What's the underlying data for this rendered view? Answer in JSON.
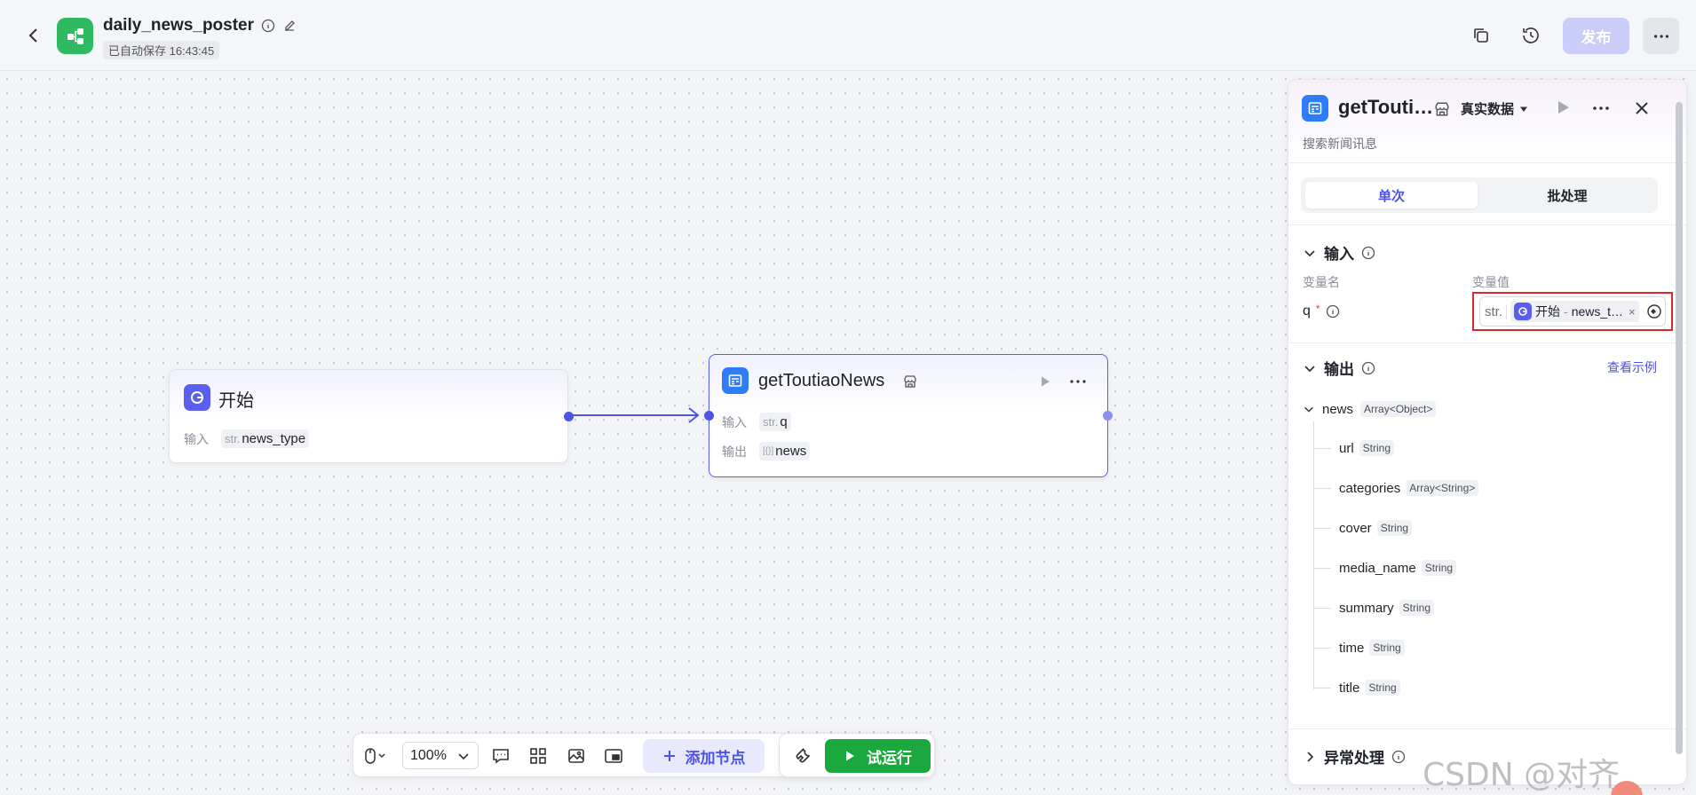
{
  "header": {
    "title": "daily_news_poster",
    "autosave": "已自动保存 16:43:45",
    "publish_label": "发布"
  },
  "canvas": {
    "start_node": {
      "title": "开始",
      "input_label": "输入",
      "input_type": "str.",
      "input_name": "news_type"
    },
    "news_node": {
      "title": "getToutiaoNews",
      "input_label": "输入",
      "input_type": "str.",
      "input_name": "q",
      "output_label": "输出",
      "output_type": "[{}]",
      "output_name": "news"
    }
  },
  "toolbar": {
    "zoom": "100%",
    "add_node_label": "添加节点",
    "run_label": "试运行"
  },
  "panel": {
    "title": "getTouti…",
    "data_mode": "真实数据",
    "description": "搜索新闻讯息",
    "tabs": [
      "单次",
      "批处理"
    ],
    "input_section": "输入",
    "col_var_name": "变量名",
    "col_var_value": "变量值",
    "param": {
      "name": "q",
      "required_mark": "*",
      "type": "str.",
      "ref_node": "开始",
      "ref_sep": "-",
      "ref_var": "news_t…",
      "remove": "×"
    },
    "output_section": "输出",
    "example_link": "查看示例",
    "output_root": {
      "name": "news",
      "type": "Array<Object>"
    },
    "output_fields": [
      {
        "name": "url",
        "type": "String"
      },
      {
        "name": "categories",
        "type": "Array<String>"
      },
      {
        "name": "cover",
        "type": "String"
      },
      {
        "name": "media_name",
        "type": "String"
      },
      {
        "name": "summary",
        "type": "String"
      },
      {
        "name": "time",
        "type": "String"
      },
      {
        "name": "title",
        "type": "String"
      }
    ],
    "exception_section": "异常处理"
  },
  "watermark": "CSDN @对齐token",
  "colors": {
    "accent": "#4d53e8",
    "run_green": "#1ba83f",
    "highlight_red": "#e0242b",
    "app_logo_green": "#2fb961"
  }
}
